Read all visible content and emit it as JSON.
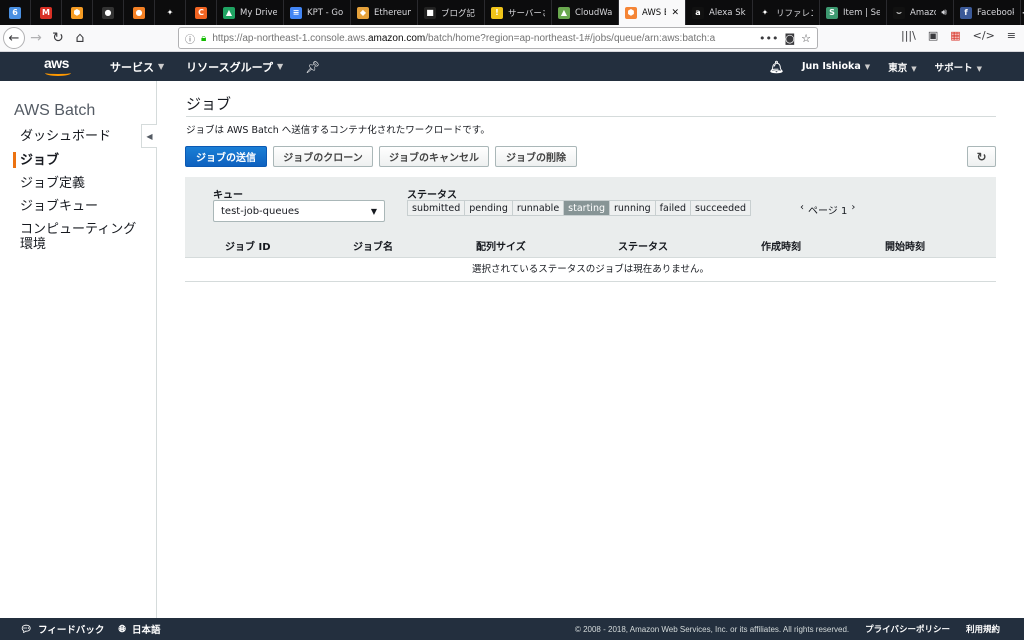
{
  "browser": {
    "tabs": [
      {
        "title": "",
        "favicon": "calendar-icon",
        "color": "#4a90e2",
        "glyph": "6"
      },
      {
        "title": "",
        "favicon": "gmail-icon",
        "color": "#d93025",
        "glyph": "M"
      },
      {
        "title": "",
        "favicon": "hexagon-icon",
        "color": "#f59b23",
        "glyph": "⬢"
      },
      {
        "title": "",
        "favicon": "github-icon",
        "color": "#333333",
        "glyph": "●"
      },
      {
        "title": "",
        "favicon": "circle-orange-icon",
        "color": "#f48024",
        "glyph": "●"
      },
      {
        "title": "",
        "favicon": "star-icon",
        "color": "#0c0c0d",
        "glyph": "✦"
      },
      {
        "title": "",
        "favicon": "refresh-app-icon",
        "color": "#f16422",
        "glyph": "C"
      },
      {
        "title": "My Drive",
        "favicon": "drive-icon",
        "color": "#1fa463",
        "glyph": "▲"
      },
      {
        "title": "KPT - Go",
        "favicon": "docs-icon",
        "color": "#4285f4",
        "glyph": "≡"
      },
      {
        "title": "Ethereum",
        "favicon": "ethereum-icon",
        "color": "#e5a13b",
        "glyph": "◆"
      },
      {
        "title": "ブログ記",
        "favicon": "blog-icon",
        "color": "#222222",
        "glyph": "■"
      },
      {
        "title": "サーバーさ",
        "favicon": "warning-icon",
        "color": "#f0c419",
        "glyph": "!"
      },
      {
        "title": "CloudWat",
        "favicon": "cloudwatch-icon",
        "color": "#6aa84f",
        "glyph": "▲"
      },
      {
        "title": "AWS B",
        "favicon": "aws-icon",
        "color": "#f58536",
        "glyph": "⬢",
        "active": true
      },
      {
        "title": "Alexa Skil",
        "favicon": "amazon-icon",
        "color": "#111111",
        "glyph": "a"
      },
      {
        "title": "リファレン",
        "favicon": "star-icon",
        "color": "#0c0c0d",
        "glyph": "✦"
      },
      {
        "title": "Item | Sei",
        "favicon": "item-icon",
        "color": "#3d9970",
        "glyph": "S"
      },
      {
        "title": "Amazo",
        "favicon": "amazon-icon",
        "color": "#111111",
        "glyph": "⌣",
        "audio": true
      },
      {
        "title": "Facebook",
        "favicon": "facebook-icon",
        "color": "#3b5998",
        "glyph": "f"
      }
    ],
    "url_prefix": "https://ap-northeast-1.console.aws.",
    "url_domain": "amazon.com",
    "url_suffix": "/batch/home?region=ap-northeast-1#/jobs/queue/arn:aws:batch:a"
  },
  "aws_header": {
    "logo": "aws",
    "services": "サービス",
    "resource_groups": "リソースグループ",
    "user": "Jun Ishioka",
    "region": "東京",
    "support": "サポート"
  },
  "sidebar": {
    "title": "AWS Batch",
    "items": [
      {
        "label": "ダッシュボード"
      },
      {
        "label": "ジョブ",
        "active": true
      },
      {
        "label": "ジョブ定義"
      },
      {
        "label": "ジョブキュー"
      },
      {
        "label": "コンピューティング"
      },
      {
        "label": "環境"
      }
    ]
  },
  "main": {
    "title": "ジョブ",
    "description": "ジョブは AWS Batch へ送信するコンテナ化されたワークロードです。",
    "buttons": {
      "submit": "ジョブの送信",
      "clone": "ジョブのクローン",
      "cancel": "ジョブのキャンセル",
      "delete": "ジョブの削除"
    },
    "filter": {
      "queue_label": "キュー",
      "queue_value": "test-job-queues",
      "status_label": "ステータス",
      "statuses": [
        "submitted",
        "pending",
        "runnable",
        "starting",
        "running",
        "failed",
        "succeeded"
      ],
      "selected_status": "starting",
      "pager_prev": "‹",
      "pager_text": "ページ 1",
      "pager_next": "›"
    },
    "table": {
      "columns": [
        "ジョブ ID",
        "ジョブ名",
        "配列サイズ",
        "ステータス",
        "作成時刻",
        "開始時刻"
      ],
      "empty_message": "選択されているステータスのジョブは現在ありません。"
    }
  },
  "footer": {
    "feedback": "フィードバック",
    "language": "日本語",
    "copyright": "© 2008 - 2018, Amazon Web Services, Inc. or its affiliates. All rights reserved.",
    "privacy": "プライバシーポリシー",
    "terms": "利用規約"
  }
}
